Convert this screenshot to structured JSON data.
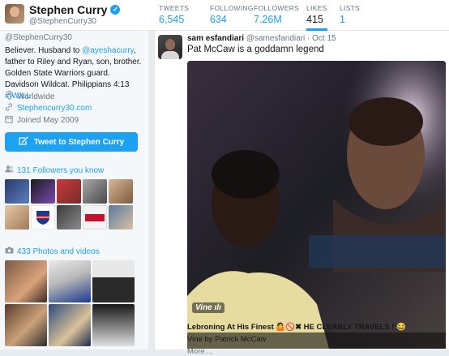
{
  "profile": {
    "name": "Stephen Curry",
    "handle": "@StephenCurry30",
    "bio_prefix": "Believer. Husband to ",
    "bio_link1": "@ayeshacurry",
    "bio_mid": ", father to Riley and Ryan, son, brother. Golden State Warriors guard. Davidson Wildcat. Philippians 4:13 ",
    "bio_link2": "#IWILL",
    "location": "Worldwide",
    "website": "Stephencurry30.com",
    "joined": "Joined May 2009",
    "tweet_button": "Tweet to Stephen Curry",
    "followers_you_know": "131 Followers you know",
    "photos_videos": "433 Photos and videos"
  },
  "stats": [
    {
      "label": "TWEETS",
      "value": "6,545"
    },
    {
      "label": "FOLLOWING",
      "value": "634"
    },
    {
      "label": "FOLLOWERS",
      "value": "7.26M"
    },
    {
      "label": "LIKES",
      "value": "415"
    },
    {
      "label": "LISTS",
      "value": "1"
    }
  ],
  "active_tab": "LIKES",
  "tweet": {
    "author": "sam esfandiari",
    "handle": "@samesfandiari",
    "date": "Oct 15",
    "text": "Pat McCaw is a goddamn legend",
    "video_caption": "Lebroning At His Finest 🤷🚫✖ HE CLEARLY TRAVELS ! 😂",
    "video_by": "Vine by Patrick McCaw",
    "more": "More ..."
  },
  "vine_badge": "Vine",
  "colors": {
    "accent": "#1da1f2",
    "background": "#e6ecf0",
    "sidebar": "#f5f8fa"
  },
  "icons": [
    "verified-icon",
    "location-icon",
    "link-icon",
    "calendar-icon",
    "vine-icon",
    "people-icon",
    "camera-icon"
  ]
}
